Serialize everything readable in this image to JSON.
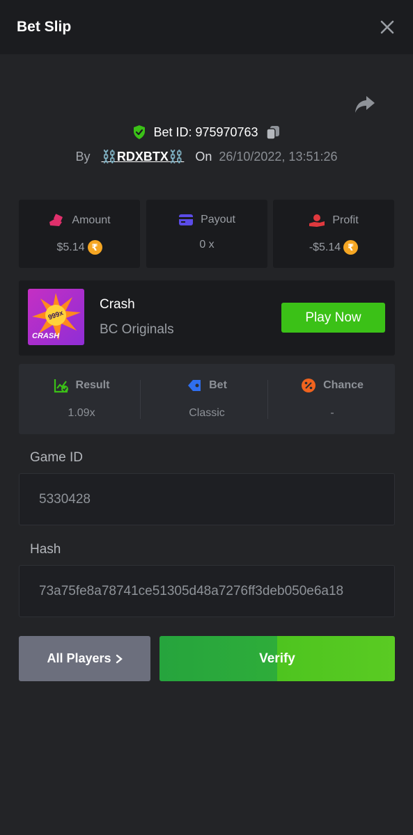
{
  "header": {
    "title": "Bet Slip"
  },
  "bet": {
    "id_label": "Bet ID: 975970763",
    "by_label": "By",
    "user": "⛓️RDXBTX⛓️",
    "on_label": "On",
    "datetime": "26/10/2022, 13:51:26"
  },
  "stats": {
    "amount": {
      "label": "Amount",
      "value": "$5.14",
      "currency_symbol": "₹"
    },
    "payout": {
      "label": "Payout",
      "value": "0 x"
    },
    "profit": {
      "label": "Profit",
      "value": "-$5.14",
      "currency_symbol": "₹"
    }
  },
  "game": {
    "name": "Crash",
    "provider": "BC Originals",
    "thumb_badge": "999x",
    "thumb_label": "CRASH",
    "play_label": "Play Now"
  },
  "info": {
    "result": {
      "label": "Result",
      "value": "1.09x"
    },
    "bet": {
      "label": "Bet",
      "value": "Classic"
    },
    "chance": {
      "label": "Chance",
      "value": "-"
    }
  },
  "fields": {
    "game_id": {
      "label": "Game ID",
      "value": "5330428"
    },
    "hash": {
      "label": "Hash",
      "value": "73a75fe8a78741ce51305d48a7276ff3deb050e6a18"
    }
  },
  "actions": {
    "all_players_label": "All Players",
    "verify_label": "Verify"
  },
  "colors": {
    "background": "#232427",
    "header": "#1b1c1f",
    "card": "#1a1b1e",
    "green": "#3bc117",
    "coin": "#f5a623"
  },
  "icons": [
    "close-icon",
    "share-icon",
    "shield-check-icon",
    "copy-icon",
    "amount-icon",
    "payout-card-icon",
    "profit-hand-icon",
    "result-chart-icon",
    "bet-tag-icon",
    "chance-percent-icon",
    "chevron-right-icon"
  ]
}
